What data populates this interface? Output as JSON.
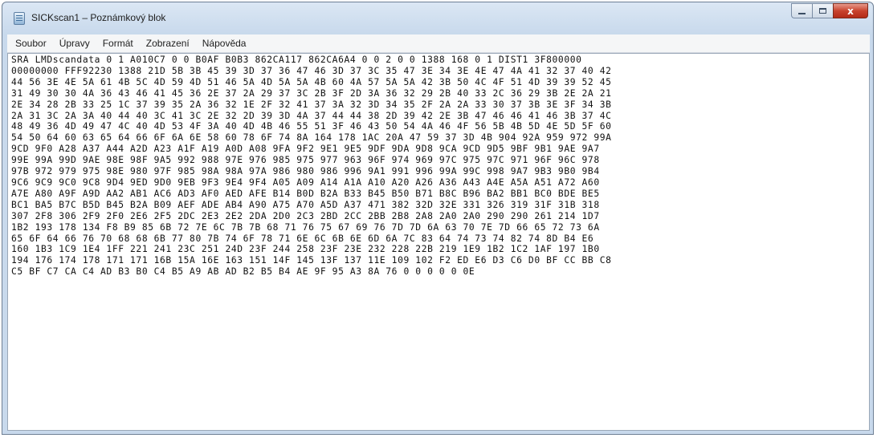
{
  "window": {
    "title": "SICKscan1 – Poznámkový blok",
    "caption": {
      "minimize_icon": "minimize-icon",
      "maximize_icon": "maximize-icon",
      "close_glyph": "x"
    }
  },
  "menu": {
    "items": [
      "Soubor",
      "Úpravy",
      "Formát",
      "Zobrazení",
      "Nápověda"
    ]
  },
  "document": {
    "text": "SRA LMDscandata 0 1 A010C7 0 0 B0AF B0B3 862CA117 862CA6A4 0 0 2 0 0 1388 168 0 1 DIST1 3F800000\n00000000 FFF92230 1388 21D 5B 3B 45 39 3D 37 36 47 46 3D 37 3C 35 47 3E 34 3E 4E 47 4A 41 32 37 40 42\n44 56 3E 4E 5A 61 4B 5C 4D 59 4D 51 46 5A 4D 5A 5A 4B 60 4A 57 5A 5A 42 3B 50 4C 4F 51 4D 39 39 52 45\n31 49 30 30 4A 36 43 46 41 45 36 2E 37 2A 29 37 3C 2B 3F 2D 3A 36 32 29 2B 40 33 2C 36 29 3B 2E 2A 21\n2E 34 28 2B 33 25 1C 37 39 35 2A 36 32 1E 2F 32 41 37 3A 32 3D 34 35 2F 2A 2A 33 30 37 3B 3E 3F 34 3B\n2A 31 3C 2A 3A 40 44 40 3C 41 3C 2E 32 2D 39 3D 4A 37 44 44 38 2D 39 42 2E 3B 47 46 46 41 46 3B 37 4C\n48 49 36 4D 49 47 4C 40 4D 53 4F 3A 40 4D 4B 46 55 51 3F 46 43 50 54 4A 46 4F 56 5B 4B 5D 4E 5D 5F 60\n54 50 64 60 63 65 64 66 6F 6A 6E 58 60 78 6F 74 8A 164 178 1AC 20A 47 59 37 3D 4B 904 92A 959 972 99A\n9CD 9F0 A28 A37 A44 A2D A23 A1F A19 A0D A08 9FA 9F2 9E1 9E5 9DF 9DA 9D8 9CA 9CD 9D5 9BF 9B1 9AE 9A7\n99E 99A 99D 9AE 98E 98F 9A5 992 988 97E 976 985 975 977 963 96F 974 969 97C 975 97C 971 96F 96C 978\n97B 972 979 975 98E 980 97F 985 98A 98A 97A 986 980 986 996 9A1 991 996 99A 99C 998 9A7 9B3 9B0 9B4\n9C6 9C9 9C0 9C8 9D4 9ED 9D0 9EB 9F3 9E4 9F4 A05 A09 A14 A1A A10 A20 A26 A36 A43 A4E A5A A51 A72 A60\nA7E A80 A9F A9D AA2 AB1 AC6 AD3 AF0 AED AFE B14 B0D B2A B33 B45 B50 B71 B8C B96 BA2 BB1 BC0 BDE BE5\nBC1 BA5 B7C B5D B45 B2A B09 AEF ADE AB4 A90 A75 A70 A5D A37 471 382 32D 32E 331 326 319 31F 31B 318\n307 2F8 306 2F9 2F0 2E6 2F5 2DC 2E3 2E2 2DA 2D0 2C3 2BD 2CC 2BB 2B8 2A8 2A0 2A0 290 290 261 214 1D7\n1B2 193 178 134 F8 B9 85 6B 72 7E 6C 7B 7B 68 71 76 75 67 69 76 7D 7D 6A 63 70 7E 7D 66 65 72 73 6A\n65 6F 64 66 76 70 68 68 6B 77 80 7B 74 6F 78 71 6E 6C 6B 6E 6D 6A 7C 83 64 74 73 74 82 74 8D B4 E6\n160 1B3 1C9 1E4 1FF 221 241 23C 251 24D 23F 244 258 23F 23E 232 228 22B 219 1E9 1B2 1C2 1AF 197 1B0\n194 176 174 178 171 171 16B 15A 16E 163 151 14F 145 13F 137 11E 109 102 F2 ED E6 D3 C6 D0 BF CC BB C8\nC5 BF C7 CA C4 AD B3 B0 C4 B5 A9 AB AD B2 B5 B4 AE 9F 95 A3 8A 76 0 0 0 0 0 0E"
  }
}
